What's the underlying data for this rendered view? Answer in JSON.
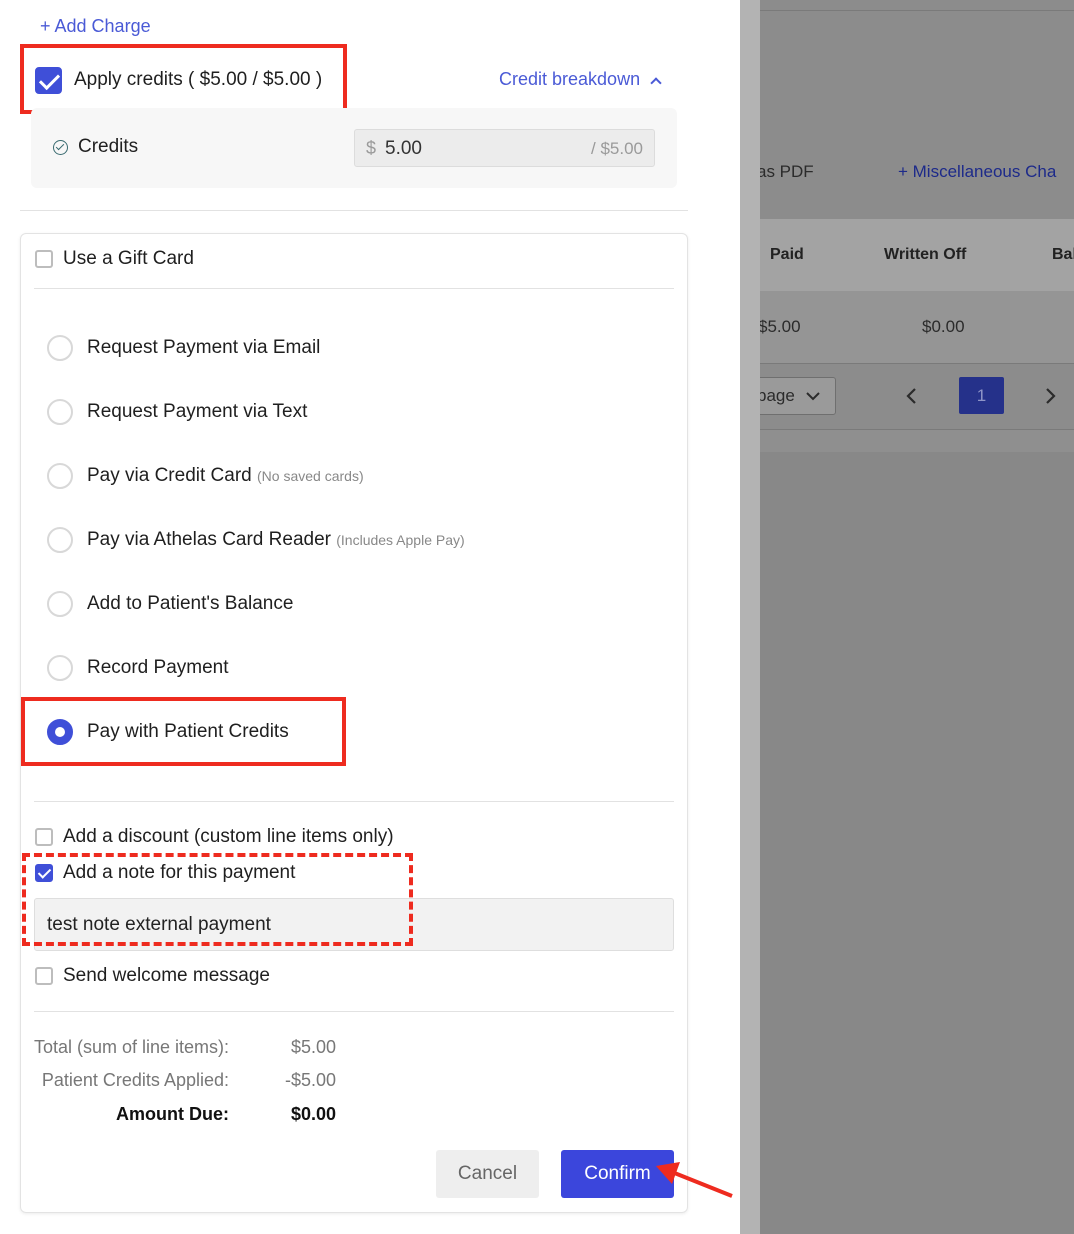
{
  "add_charge": {
    "label": "+ Add Charge"
  },
  "apply_credits": {
    "label": "Apply credits ( $5.00 / $5.00 )",
    "checked": true
  },
  "credit_breakdown": {
    "label": "Credit breakdown"
  },
  "credits_row": {
    "label": "Credits",
    "currency": "$",
    "value": "5.00",
    "max": "/ $5.00"
  },
  "gift_card": {
    "label": "Use a Gift Card",
    "checked": false
  },
  "payment_options": [
    {
      "label": "Request Payment via Email",
      "note": "",
      "selected": false
    },
    {
      "label": "Request Payment via Text",
      "note": "",
      "selected": false
    },
    {
      "label": "Pay via Credit Card",
      "note": "(No saved cards)",
      "selected": false
    },
    {
      "label": "Pay via Athelas Card Reader",
      "note": "(Includes Apple Pay)",
      "selected": false
    },
    {
      "label": "Add to Patient's Balance",
      "note": "",
      "selected": false
    },
    {
      "label": "Record Payment",
      "note": "",
      "selected": false
    },
    {
      "label": "Pay with Patient Credits",
      "note": "",
      "selected": true
    }
  ],
  "extras": {
    "discount": {
      "label": "Add a discount (custom line items only)",
      "checked": false
    },
    "note": {
      "label": "Add a note for this payment",
      "checked": true,
      "value": "test note external payment"
    },
    "welcome": {
      "label": "Send welcome message",
      "checked": false
    }
  },
  "summary": {
    "total_label": "Total (sum of line items):",
    "total_value": "$5.00",
    "credits_label": "Patient Credits Applied:",
    "credits_value": "-$5.00",
    "due_label": "Amount Due:",
    "due_value": "$0.00"
  },
  "buttons": {
    "cancel": "Cancel",
    "confirm": "Confirm"
  },
  "background": {
    "pdf_link": "as PDF",
    "misc_link": "+ Miscellaneous Cha",
    "headers": [
      "Paid",
      "Written Off",
      "Bal"
    ],
    "row": [
      "$5.00",
      "$0.00"
    ],
    "per_page": "page",
    "page_number": "1"
  },
  "colors": {
    "accent": "#3b46dc",
    "annotation": "#ee2b1f"
  }
}
